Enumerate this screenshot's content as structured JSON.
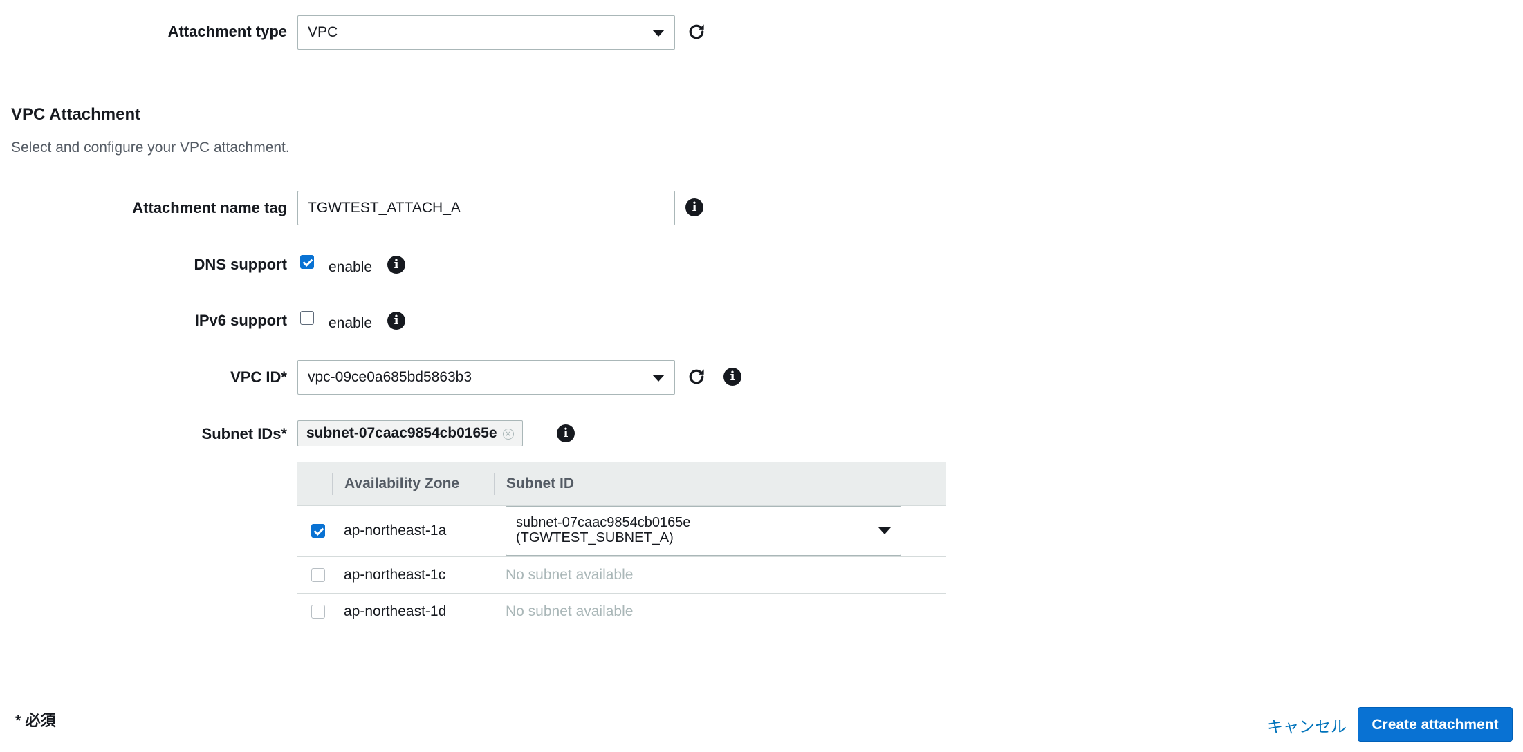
{
  "attachment_type": {
    "label": "Attachment type",
    "value": "VPC"
  },
  "section": {
    "title": "VPC Attachment",
    "description": "Select and configure your VPC attachment."
  },
  "name_tag": {
    "label": "Attachment name tag",
    "value": "TGWTEST_ATTACH_A"
  },
  "dns_support": {
    "label": "DNS support",
    "checked": true,
    "option_label": "enable"
  },
  "ipv6_support": {
    "label": "IPv6 support",
    "checked": false,
    "option_label": "enable"
  },
  "vpc_id": {
    "label": "VPC ID*",
    "value": "vpc-09ce0a685bd5863b3"
  },
  "subnet_ids": {
    "label": "Subnet IDs*",
    "token": "subnet-07caac9854cb0165e",
    "columns": [
      "Availability Zone",
      "Subnet ID"
    ],
    "rows": [
      {
        "checked": true,
        "disabled": false,
        "zone": "ap-northeast-1a",
        "subnet_line1": "subnet-07caac9854cb0165e",
        "subnet_line2": "(TGWTEST_SUBNET_A)"
      },
      {
        "checked": false,
        "disabled": true,
        "zone": "ap-northeast-1c",
        "subnet_text": "No subnet available"
      },
      {
        "checked": false,
        "disabled": true,
        "zone": "ap-northeast-1d",
        "subnet_text": "No subnet available"
      }
    ]
  },
  "footer": {
    "required_note": "* 必須",
    "cancel_label": "キャンセル",
    "create_label": "Create attachment"
  },
  "icons": {
    "info": "info-icon",
    "refresh": "refresh-icon",
    "caret": "caret-down-icon",
    "remove": "remove-token-icon"
  },
  "colors": {
    "primary": "#0972d3",
    "link": "#0073bb",
    "table_header": "#eaeded"
  }
}
